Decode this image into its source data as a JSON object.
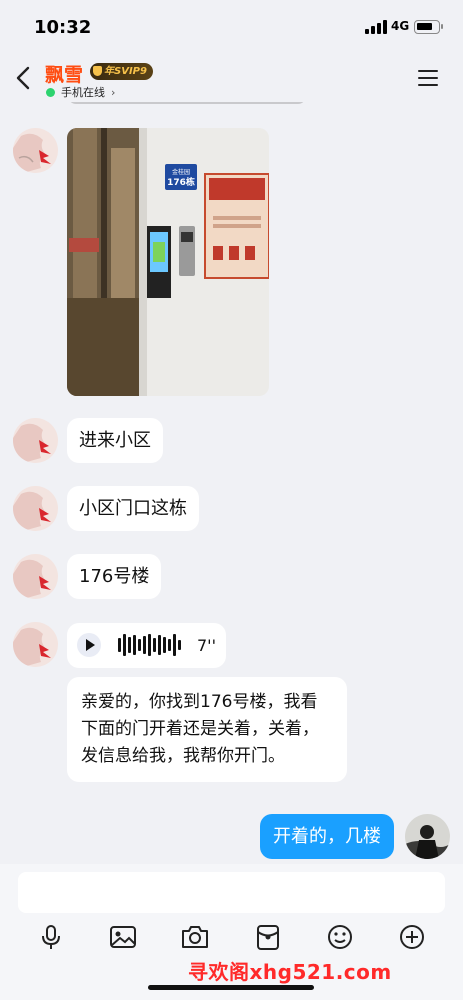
{
  "status_bar": {
    "time": "10:32",
    "network": "4G"
  },
  "header": {
    "contact_name": "飘雪",
    "vip_badge": "年SVIP9",
    "online_status": "手机在线",
    "online_color": "#2dd36f",
    "name_color": "#ff4d12"
  },
  "messages": {
    "m1": {
      "sender": "contact",
      "type": "image"
    },
    "m2": {
      "sender": "contact",
      "type": "text",
      "text": "进来小区"
    },
    "m3": {
      "sender": "contact",
      "type": "text",
      "text": "小区门口这栋"
    },
    "m4": {
      "sender": "contact",
      "type": "text",
      "text": "176号楼"
    },
    "m5": {
      "sender": "contact",
      "type": "voice",
      "duration": "7''"
    },
    "m6": {
      "sender": "contact",
      "type": "text",
      "text": "亲爱的，你找到176号楼，我看下面的门开着还是关着，关着，发信息给我，我帮你开门。"
    },
    "m7": {
      "sender": "me",
      "type": "text",
      "text": "开着的，几楼"
    }
  },
  "photo": {
    "sign_top": "金桂园",
    "sign_number": "176栋"
  },
  "input": {
    "value": "",
    "placeholder": ""
  },
  "toolbar": [
    "microphone-icon",
    "image-icon",
    "camera-icon",
    "red-packet-icon",
    "emoji-icon",
    "plus-icon"
  ],
  "sent_bubble_color": "#1aa0ff",
  "watermark": "寻欢阁xhg521.com"
}
